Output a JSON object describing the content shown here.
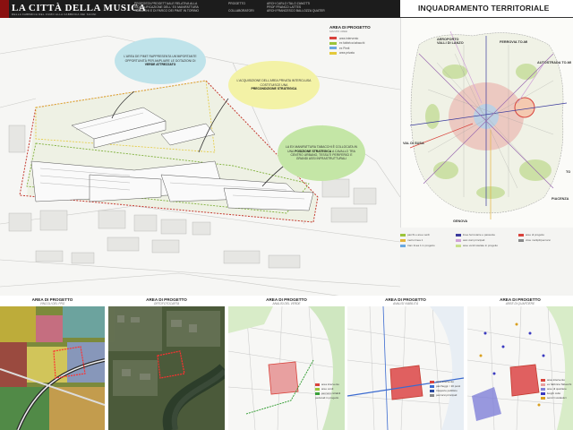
{
  "header": {
    "title": "LA CITTÀ DELLA MUSICA",
    "subtitle": "DELLA FABBRICA DEL FUMO ALLA FABBRICA DEI SUONI",
    "col1": "PROPOSTA PROGETTUALE RELATIVA ALLA\nRIQUALIFICAZIONE DELL' EX MANIFATTURA\nTABACCHI E DI PARCO DEI PIMIT IN TORINO",
    "col2": "PROGETTO\n\nCOLLABORATORI",
    "col3": "ARCH CARLO ITALO ZANOTTI\nPROF FRANCO LATTES\nARCH FRANCESCO BALLOZZA QUATER",
    "right_title": "INQUADRAMENTO TERRITORIALE"
  },
  "bubbles": {
    "b1": "L'AREA DE PIMIT RAPPRESENTA UN'IMPORTANTE OPPORTUNITÀ PER AMPLIARE LE DOTAZIONI DI",
    "b1_bold": "VERDE ATTREZZATO",
    "b2": "L'ACQUISIZIONE DELL'AREA PRIVATA INTERCLUSA COSTITUISCE UNA",
    "b2_bold": "PRECONDIZIONE STRATEGICA",
    "b3a": "LA EX MANIFATTURA TABACCHI È COLLOCATA IN UNA",
    "b3_bold": "POSIZIONE STRATEGICA",
    "b3b": "A CAVALLO TRA CENTRO URBANO, TESSUTI PERIFERICI E GRANDI ASSI INFRASTRUTTURALI"
  },
  "legend1": {
    "title": "AREA DI PROGETTO",
    "subtitle": "MACRO AREE",
    "items": [
      "area intervento",
      "ex fabbrica tabacchi",
      "ex Pimit",
      "area privata"
    ],
    "colors": [
      "#d9433c",
      "#9bc43a",
      "#6aa8e0",
      "#e4c93a"
    ]
  },
  "map": {
    "labels": {
      "aeroporto": "AEROPORTO\nVALLI DI LANZO",
      "ferrovia": "FERROVIA TO-MI",
      "autostrada": "AUTOSTRADA TO-MI",
      "valdisusa": "VAL DI SUSA",
      "genova": "GENOVA",
      "torino": "TO",
      "piacenza": "PIACENZA"
    }
  },
  "legend2": {
    "items": [
      "parchi e aree verdi",
      "linee ferroviarie e passante",
      "aree di progetto",
      "metro linea 1",
      "assi viari principali",
      "viste multipli/percorsi",
      "tram linea 1 in progetto",
      "aree verdi tutelate in progetto"
    ],
    "colors": [
      "#9bc43a",
      "#3a3a9c",
      "#d9433c",
      "#e4b43a",
      "#d0a2d8",
      "#888888",
      "#6aa8e0",
      "#c8e08a"
    ]
  },
  "panels": [
    {
      "title": "AREA DI PROGETTO",
      "sub": "VINCOLI DEL PRG"
    },
    {
      "title": "AREA DI PROGETTO",
      "sub": "ORTOFOTOCARTA"
    },
    {
      "title": "AREA DI PROGETTO",
      "sub": "ANALISI DEL VERDE"
    },
    {
      "title": "AREA DI PROGETTO",
      "sub": "ANALISI VIABILITÀ"
    },
    {
      "title": "AREA DI PROGETTO",
      "sub": "AREE DI QUARTIERE"
    }
  ],
  "panel3_legend": [
    "area intervento",
    "aree verdi",
    "percorsi ciclabili pedonali in progetto"
  ],
  "panel4_legend": [
    "area intervento",
    "parcheggi < 20 posti",
    "trasporto pubblico",
    "percorsi principali"
  ],
  "panel5_legend": [
    "area intervento",
    "ex fabbrica Tabacchi",
    "aree di quartiere",
    "luoghi culto",
    "servizi scolastici"
  ]
}
